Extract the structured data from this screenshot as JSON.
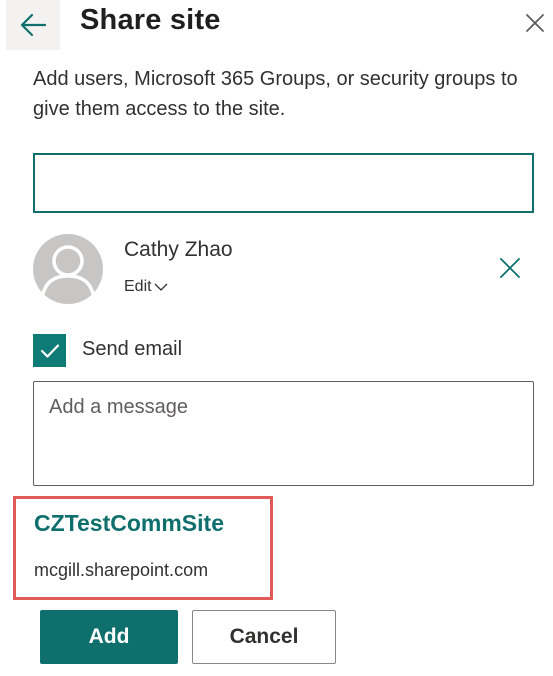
{
  "header": {
    "back_icon": "arrow-left-icon",
    "title": "Share site",
    "close_icon": "close-icon"
  },
  "description": "Add users, Microsoft 365 Groups, or security groups to give them access to the site.",
  "people_picker": {
    "value": "",
    "placeholder": ""
  },
  "person": {
    "name": "Cathy Zhao",
    "permission": "Edit",
    "avatar_icon": "person-placeholder-icon",
    "remove_icon": "close-icon"
  },
  "send_email": {
    "checked": true,
    "label": "Send email"
  },
  "message": {
    "value": "",
    "placeholder": "Add a message"
  },
  "site": {
    "name": "CZTestCommSite",
    "url": "mcgill.sharepoint.com"
  },
  "buttons": {
    "add_label": "Add",
    "cancel_label": "Cancel"
  },
  "colors": {
    "accent": "#0f6f6c",
    "highlight_border": "#e05a5a"
  }
}
